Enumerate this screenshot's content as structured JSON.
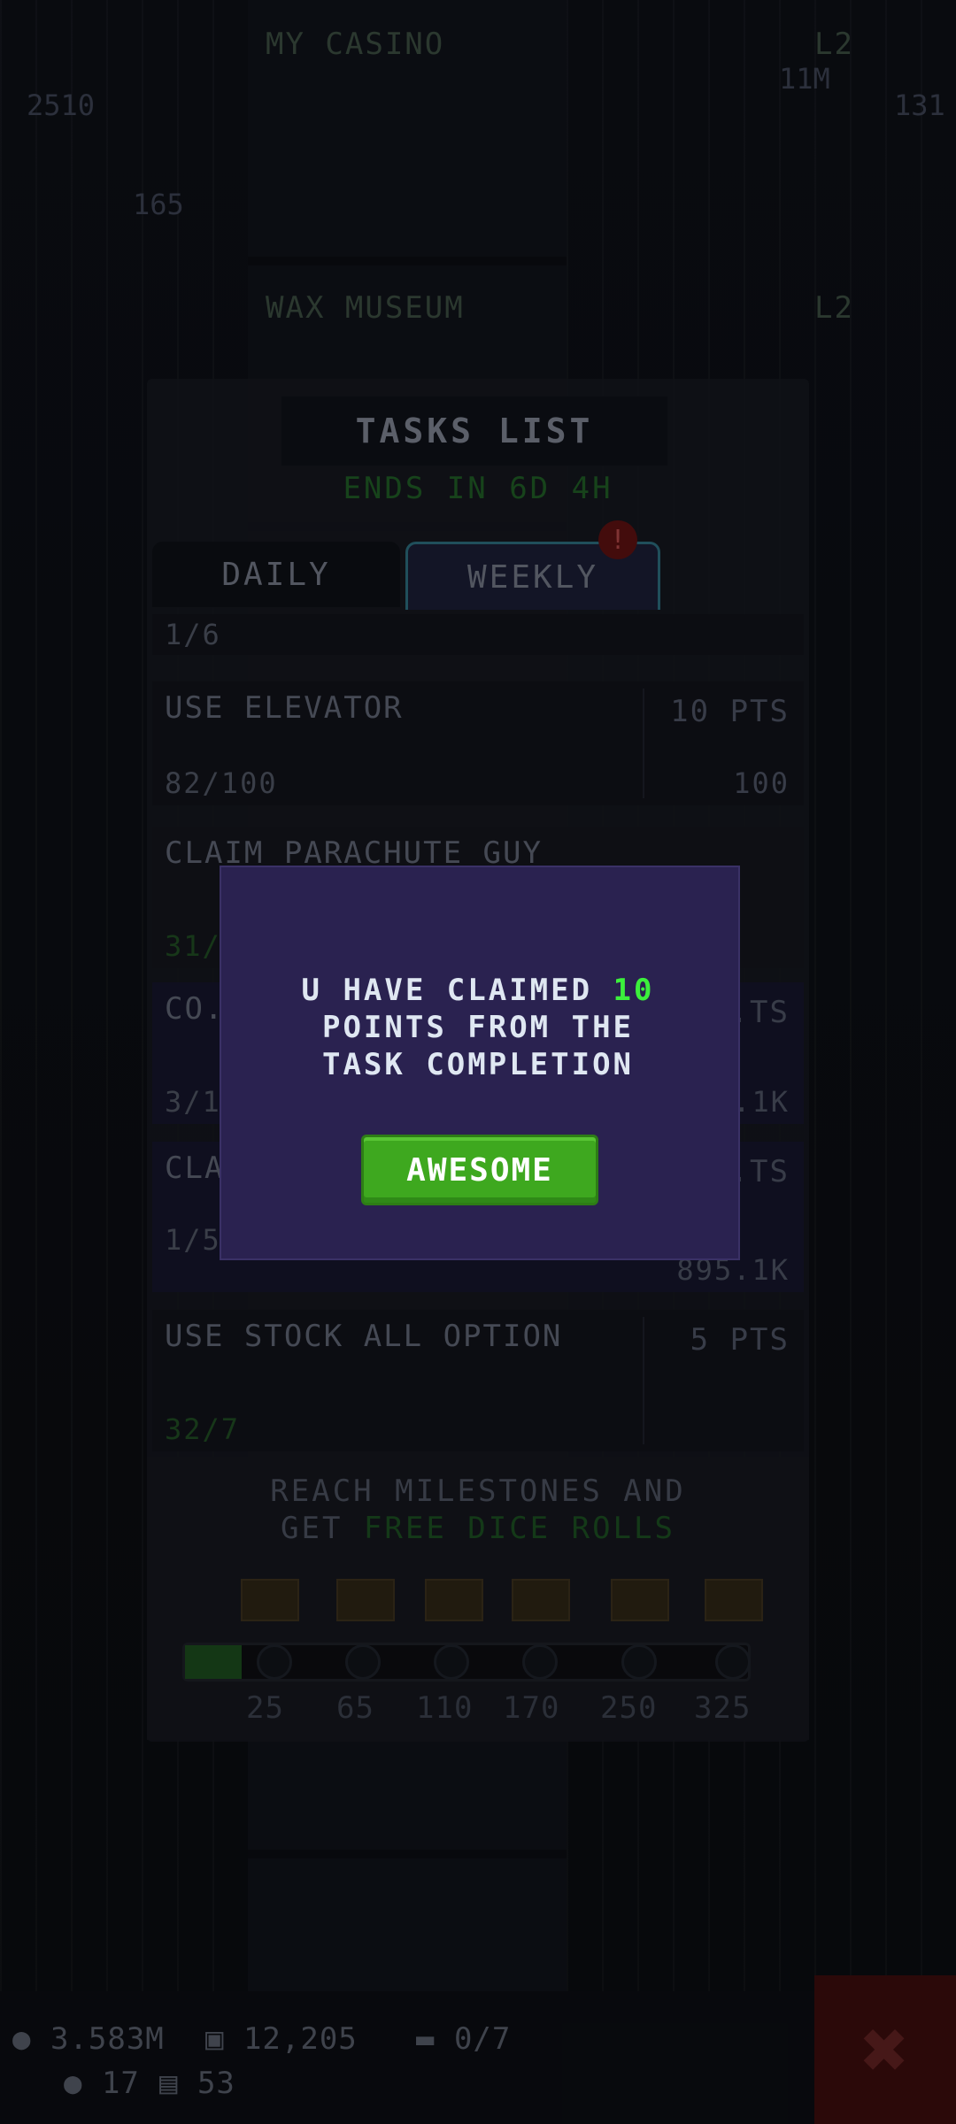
{
  "background": {
    "floors": [
      {
        "title": "MY CASINO",
        "level": "L2"
      },
      {
        "title": "WAX MUSEUM",
        "level": "L2"
      }
    ],
    "left_counters": [
      "2510",
      "165"
    ],
    "right_counters": [
      "131",
      "11M"
    ]
  },
  "tasks_panel": {
    "title": "TASKS LIST",
    "ends_in": "ENDS IN 6D 4H",
    "tabs": [
      {
        "label": "DAILY"
      },
      {
        "label": "WEEKLY",
        "badge": "!"
      }
    ],
    "tasks": [
      {
        "label": "",
        "progress": "1/6",
        "points": "",
        "reward": ""
      },
      {
        "label": "USE ELEVATOR",
        "progress": "82/100",
        "points": "10 PTS",
        "reward": "100"
      },
      {
        "label": "CLAIM PARACHUTE GUY",
        "progress": "31/...",
        "points": "",
        "reward": ""
      },
      {
        "label": "CO...",
        "progress": "3/1...",
        "points": "...TS",
        "reward": "...1K"
      },
      {
        "label": "CLA...",
        "progress": "1/5",
        "points": "...TS",
        "reward": "895.1K"
      },
      {
        "label": "USE STOCK ALL OPTION",
        "progress": "32/7",
        "points": "5 PTS",
        "reward": ""
      }
    ],
    "milestones": {
      "text_line1": "REACH MILESTONES AND",
      "text_line2_prefix": "GET ",
      "text_line2_highlight": "FREE DICE ROLLS",
      "values": [
        "25",
        "65",
        "110",
        "170",
        "250",
        "325"
      ],
      "progress_fraction": 0.1
    }
  },
  "hud": {
    "coins": "3.583M",
    "bux": "12,205",
    "tickets": "0/7",
    "gems": "17",
    "vip": "53"
  },
  "dialog": {
    "line1_prefix": "U HAVE CLAIMED ",
    "line1_points": "10",
    "line2": "POINTS FROM THE",
    "line3": "TASK COMPLETION",
    "button_label": "AWESOME",
    "colors": {
      "background": "#2a2250",
      "highlight": "#3cf03c",
      "button": "#3ea81f"
    }
  }
}
